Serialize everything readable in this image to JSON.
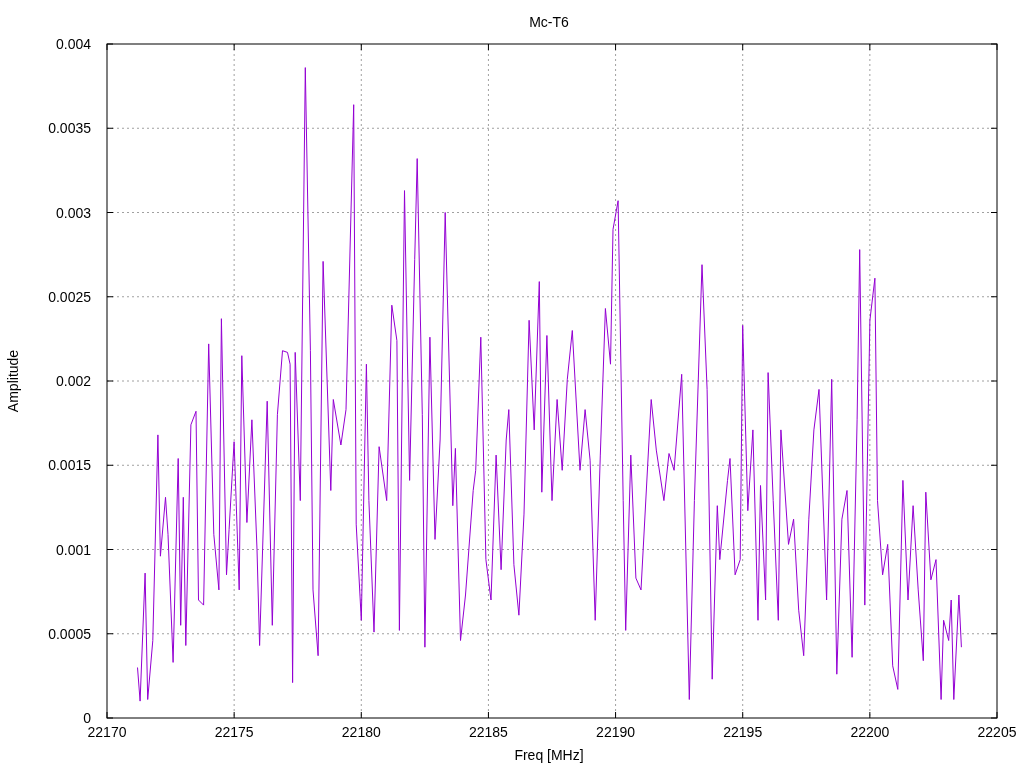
{
  "chart_data": {
    "type": "line",
    "title": "Mc-T6",
    "xlabel": "Freq [MHz]",
    "ylabel": "Amplitude",
    "xlim": [
      22170,
      22205
    ],
    "ylim": [
      0,
      0.004
    ],
    "xticks": [
      22170,
      22175,
      22180,
      22185,
      22190,
      22195,
      22200,
      22205
    ],
    "yticks": [
      0,
      0.0005,
      0.001,
      0.0015,
      0.002,
      0.0025,
      0.003,
      0.0035,
      0.004
    ],
    "x": [
      22171.2,
      22171.3,
      22171.5,
      22171.6,
      22171.8,
      22172.0,
      22172.1,
      22172.3,
      22172.4,
      22172.6,
      22172.8,
      22172.9,
      22173.0,
      22173.1,
      22173.3,
      22173.5,
      22173.6,
      22173.8,
      22174.0,
      22174.2,
      22174.4,
      22174.5,
      22174.7,
      22174.8,
      22175.0,
      22175.2,
      22175.3,
      22175.5,
      22175.7,
      22175.9,
      22176.0,
      22176.3,
      22176.5,
      22176.7,
      22176.9,
      22177.1,
      22177.2,
      22177.3,
      22177.4,
      22177.6,
      22177.8,
      22178.0,
      22178.1,
      22178.3,
      22178.5,
      22178.8,
      22178.9,
      22179.2,
      22179.4,
      22179.7,
      22179.8,
      22180.0,
      22180.2,
      22180.3,
      22180.5,
      22180.7,
      22181.0,
      22181.2,
      22181.4,
      22181.5,
      22181.7,
      22181.9,
      22182.1,
      22182.2,
      22182.4,
      22182.5,
      22182.7,
      22182.9,
      22183.1,
      22183.3,
      22183.6,
      22183.7,
      22183.9,
      22184.1,
      22184.4,
      22184.5,
      22184.7,
      22184.9,
      22185.1,
      22185.3,
      22185.5,
      22185.7,
      22185.8,
      22186.0,
      22186.2,
      22186.4,
      22186.6,
      22186.8,
      22187.0,
      22187.1,
      22187.3,
      22187.5,
      22187.7,
      22187.9,
      22188.1,
      22188.3,
      22188.6,
      22188.8,
      22189.0,
      22189.2,
      22189.4,
      22189.6,
      22189.8,
      22189.9,
      22190.1,
      22190.3,
      22190.4,
      22190.6,
      22190.8,
      22191.0,
      22191.4,
      22191.6,
      22191.9,
      22192.1,
      22192.3,
      22192.6,
      22192.9,
      22193.1,
      22193.4,
      22193.6,
      22193.8,
      22194.0,
      22194.1,
      22194.4,
      22194.5,
      22194.7,
      22194.9,
      22195.0,
      22195.2,
      22195.4,
      22195.6,
      22195.7,
      22195.9,
      22196.0,
      22196.2,
      22196.4,
      22196.5,
      22196.8,
      22197.0,
      22197.2,
      22197.4,
      22197.6,
      22197.8,
      22198.0,
      22198.3,
      22198.5,
      22198.7,
      22198.9,
      22199.1,
      22199.3,
      22199.5,
      22199.6,
      22199.8,
      22200.0,
      22200.2,
      22200.3,
      22200.5,
      22200.7,
      22200.9,
      22201.1,
      22201.3,
      22201.5,
      22201.7,
      22201.9,
      22202.1,
      22202.2,
      22202.4,
      22202.6,
      22202.8,
      22202.9,
      22203.1,
      22203.2,
      22203.3,
      22203.5,
      22203.6
    ],
    "grid": true,
    "series": [
      {
        "color": "#9400d3",
        "values": [
          0.0003,
          0.0001,
          0.00086,
          0.00011,
          0.00046,
          0.00168,
          0.00096,
          0.00131,
          0.00109,
          0.00033,
          0.00154,
          0.00055,
          0.00131,
          0.00043,
          0.00174,
          0.00182,
          0.0007,
          0.00067,
          0.00222,
          0.00109,
          0.00076,
          0.00237,
          0.00085,
          0.00112,
          0.00164,
          0.00076,
          0.00215,
          0.00116,
          0.00177,
          0.001,
          0.00043,
          0.00188,
          0.00055,
          0.0018,
          0.00218,
          0.00217,
          0.0021,
          0.00021,
          0.00217,
          0.00129,
          0.00386,
          0.00218,
          0.00076,
          0.00037,
          0.00271,
          0.00135,
          0.00189,
          0.00162,
          0.00183,
          0.00364,
          0.00115,
          0.00058,
          0.0021,
          0.00129,
          0.00051,
          0.00161,
          0.00129,
          0.00245,
          0.00224,
          0.00052,
          0.00313,
          0.00141,
          0.00272,
          0.00332,
          0.0018,
          0.00042,
          0.00226,
          0.00106,
          0.00165,
          0.003,
          0.00126,
          0.0016,
          0.00046,
          0.00073,
          0.00135,
          0.00147,
          0.00226,
          0.00094,
          0.0007,
          0.00156,
          0.00088,
          0.00165,
          0.00183,
          0.00091,
          0.00061,
          0.00121,
          0.00236,
          0.00171,
          0.00259,
          0.00134,
          0.00227,
          0.00129,
          0.00189,
          0.00147,
          0.00201,
          0.0023,
          0.00147,
          0.00183,
          0.00153,
          0.00058,
          0.00156,
          0.00243,
          0.0021,
          0.0029,
          0.00307,
          0.00129,
          0.00052,
          0.00156,
          0.00083,
          0.00076,
          0.00189,
          0.00159,
          0.00129,
          0.00157,
          0.00147,
          0.00204,
          0.00011,
          0.00129,
          0.00269,
          0.00195,
          0.00023,
          0.00126,
          0.00094,
          0.00141,
          0.00154,
          0.00085,
          0.00094,
          0.00233,
          0.00123,
          0.00171,
          0.00058,
          0.00138,
          0.0007,
          0.00205,
          0.00129,
          0.00058,
          0.00171,
          0.00103,
          0.00118,
          0.00064,
          0.00037,
          0.00118,
          0.00171,
          0.00195,
          0.0007,
          0.00201,
          0.00026,
          0.00118,
          0.00135,
          0.00036,
          0.00177,
          0.00278,
          0.00067,
          0.00236,
          0.00261,
          0.00129,
          0.00085,
          0.00103,
          0.00031,
          0.00017,
          0.00141,
          0.0007,
          0.00126,
          0.00076,
          0.00034,
          0.00134,
          0.00082,
          0.00094,
          0.00011,
          0.00058,
          0.00046,
          0.0007,
          0.00011,
          0.00073,
          0.00042
        ]
      }
    ]
  }
}
